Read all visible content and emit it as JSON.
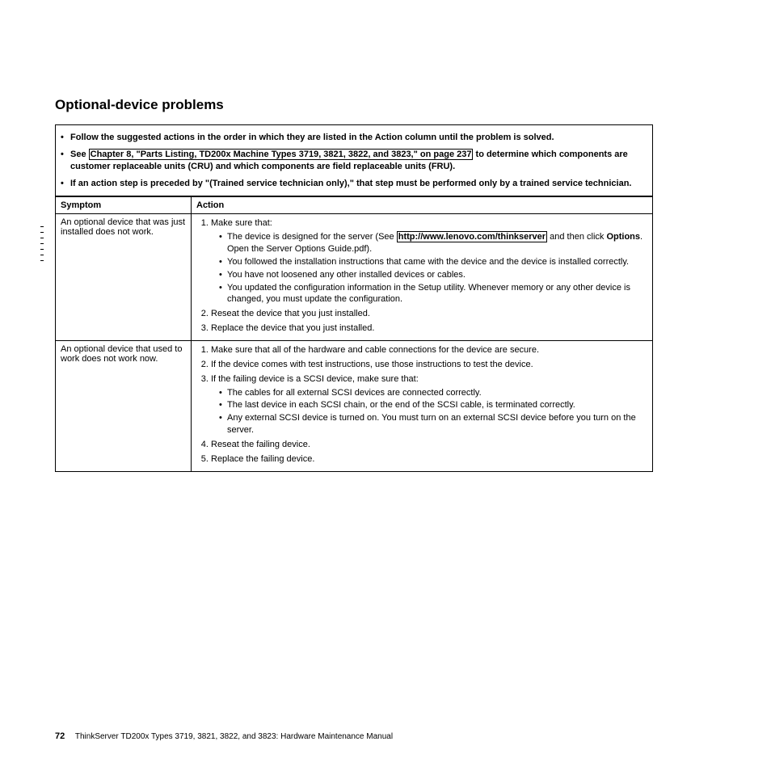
{
  "section_title": "Optional-device problems",
  "notes": {
    "n1": "Follow the suggested actions in the order in which they are listed in the Action column until the problem is solved.",
    "n2_pre": "See ",
    "n2_link": "Chapter 8, \"Parts Listing, TD200x Machine Types 3719, 3821, 3822, and 3823,\" on page 237",
    "n2_post": " to determine which components are customer replaceable units (CRU) and which components are field replaceable units (FRU).",
    "n3": "If an action step is preceded by \"(Trained service technician only),\" that step must be performed only by a trained service technician."
  },
  "headers": {
    "symptom": "Symptom",
    "action": "Action"
  },
  "row1": {
    "symptom": "An optional device that was just installed does not work.",
    "a1_lead": "Make sure that:",
    "a1_b1_pre": "The device is designed for the server (See ",
    "a1_b1_link": "http://www.lenovo.com/thinkserver",
    "a1_b1_post_a": " and then click ",
    "a1_b1_bold": "Options",
    "a1_b1_post_b": ". Open the Server Options Guide.pdf).",
    "a1_b2": "You followed the installation instructions that came with the device and the device is installed correctly.",
    "a1_b3": "You have not loosened any other installed devices or cables.",
    "a1_b4": "You updated the configuration information in the Setup utility. Whenever memory or any other device is changed, you must update the configuration.",
    "a2": "Reseat the device that you just installed.",
    "a3": "Replace the device that you just installed."
  },
  "row2": {
    "symptom": "An optional device that used to work does not work now.",
    "a1": "Make sure that all of the hardware and cable connections for the device are secure.",
    "a2": "If the device comes with test instructions, use those instructions to test the device.",
    "a3_lead": "If the failing device is a SCSI device, make sure that:",
    "a3_b1": "The cables for all external SCSI devices are connected correctly.",
    "a3_b2": "The last device in each SCSI chain, or the end of the SCSI cable, is terminated correctly.",
    "a3_b3": "Any external SCSI device is turned on. You must turn on an external SCSI device before you turn on the server.",
    "a4": "Reseat the failing device.",
    "a5": "Replace the failing device."
  },
  "footer": {
    "page_number": "72",
    "doc_title": "ThinkServer TD200x Types 3719, 3821, 3822, and 3823: Hardware Maintenance Manual"
  }
}
